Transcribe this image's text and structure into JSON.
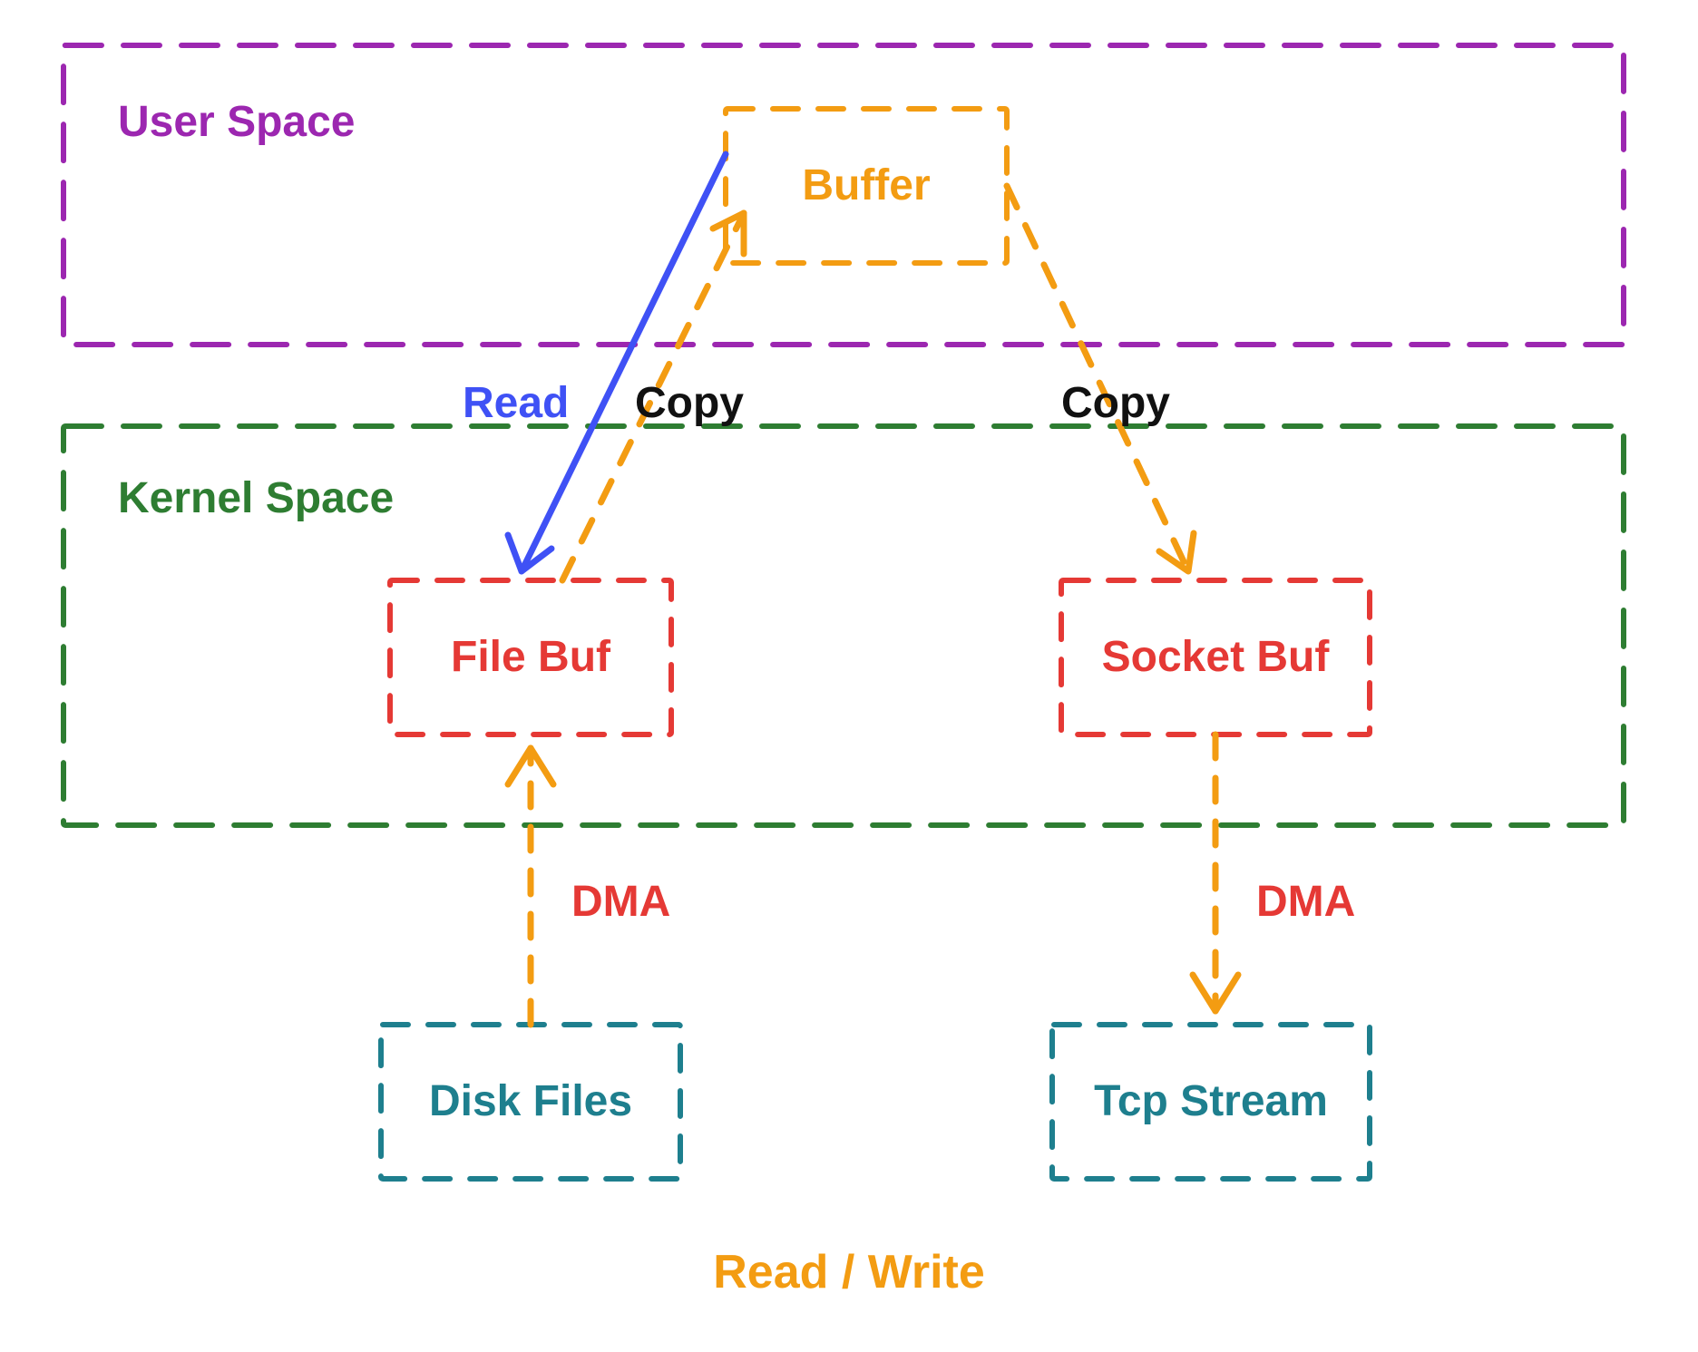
{
  "colors": {
    "purple": "#9c27b0",
    "green": "#2e7d32",
    "orange": "#f39c12",
    "red": "#e53935",
    "teal": "#1e7f8e",
    "blue": "#3f51f5",
    "black": "#111111"
  },
  "containers": {
    "user_space": {
      "label": "User Space"
    },
    "kernel_space": {
      "label": "Kernel Space"
    }
  },
  "boxes": {
    "buffer": {
      "label": "Buffer"
    },
    "file_buf": {
      "label": "File Buf"
    },
    "socket_buf": {
      "label": "Socket Buf"
    },
    "disk_files": {
      "label": "Disk Files"
    },
    "tcp_stream": {
      "label": "Tcp Stream"
    }
  },
  "edges": {
    "read": {
      "label": "Read"
    },
    "copy1": {
      "label": "Copy"
    },
    "copy2": {
      "label": "Copy"
    },
    "dma1": {
      "label": "DMA"
    },
    "dma2": {
      "label": "DMA"
    }
  },
  "caption": {
    "label": "Read / Write"
  }
}
